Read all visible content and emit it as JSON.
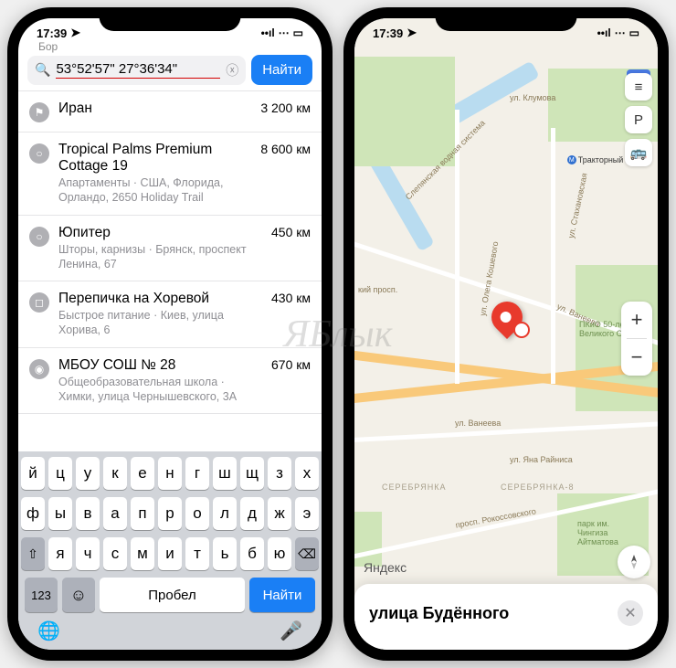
{
  "status": {
    "time": "17:39",
    "time2": "17:39"
  },
  "left": {
    "breadcrumb_hint": "Бор",
    "search_value": "53°52'57\" 27°36'34\"",
    "find_label": "Найти",
    "results": [
      {
        "icon": "⚑",
        "title": "Иран",
        "subtitle": "",
        "distance": "3 200 км"
      },
      {
        "icon": "○",
        "title": "Tropical Palms Premium Cottage 19",
        "subtitle": "Апартаменты · США, Флорида, Орландо, 2650 Holiday Trail",
        "distance": "8 600 км"
      },
      {
        "icon": "○",
        "title": "Юпитер",
        "subtitle": "Шторы, карнизы · Брянск, проспект Ленина, 67",
        "distance": "450 км"
      },
      {
        "icon": "◻",
        "title": "Перепичка на Хоревой",
        "subtitle": "Быстрое питание · Киев, улица Хорива, 6",
        "distance": "430 км"
      },
      {
        "icon": "◉",
        "title": "МБОУ СОШ № 28",
        "subtitle": "Общеобразовательная школа · Химки, улица Чернышевского, 3А",
        "distance": "670 км"
      }
    ],
    "keyboard": {
      "row1": [
        "й",
        "ц",
        "у",
        "к",
        "е",
        "н",
        "г",
        "ш",
        "щ",
        "з",
        "х"
      ],
      "row2": [
        "ф",
        "ы",
        "в",
        "а",
        "п",
        "р",
        "о",
        "л",
        "д",
        "ж",
        "э"
      ],
      "row3_shift": "⇧",
      "row3": [
        "я",
        "ч",
        "с",
        "м",
        "и",
        "т",
        "ь",
        "б",
        "ю"
      ],
      "row3_back": "⌫",
      "num_label": "123",
      "space_label": "Пробел",
      "go_label": "Найти"
    }
  },
  "right": {
    "logo": "Яндекс",
    "bottom_title": "улица Будённого",
    "controls": {
      "layers": "≡",
      "parking": "P",
      "transit": "🚌"
    },
    "streets": {
      "s1": "ул. Клумова",
      "s2": "Слепянская водная система",
      "s3": "ул. Олега Кошевого",
      "s4": "ул. Ванеева",
      "s5": "ул. Ванеева",
      "s6": "ул. Стахановская",
      "s7": "ул. Яна Райниса",
      "s8": "просп. Рокоссовского",
      "s9": "кий просп."
    },
    "metro": "Тракторный Завод",
    "park1": "ПКиО 50-летия Великого Октября",
    "park2": "парк им. Чингиза Айтматова",
    "district": "СЕРЕБРЯНКА",
    "district2": "СЕРЕБРЯНКА-8"
  },
  "watermark": "ЯБлык"
}
